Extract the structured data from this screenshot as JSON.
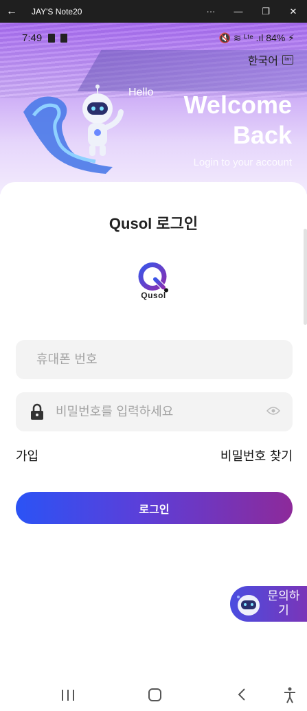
{
  "window": {
    "title": "JAY'S Note20",
    "back_glyph": "←",
    "more_glyph": "···",
    "minimize_glyph": "—",
    "restore_glyph": "❐",
    "close_glyph": "✕"
  },
  "status_bar": {
    "time": "7:49",
    "right": "🔇 ≋ ᴸᵗᵉ .ıl 84% ⚡"
  },
  "header": {
    "language": "한국어",
    "language_icon_text": "lan",
    "hello": "Hello",
    "welcome": "Welcome Back",
    "subtitle": "Login to your account"
  },
  "login": {
    "title": "Qusol 로그인",
    "logo_text": "Qusol",
    "phone_placeholder": "휴대폰 번호",
    "password_placeholder": "비밀번호를 입력하세요",
    "signup_label": "가입",
    "find_password_label": "비밀번호 찾기",
    "login_button": "로그인"
  },
  "inquiry": {
    "label": "문의하기"
  },
  "icons": {
    "lock": "lock-icon",
    "eye": "eye-icon",
    "mascot": "astronaut-mascot",
    "logo": "qusol-logo"
  },
  "colors": {
    "primary_gradient_start": "#2b53f5",
    "primary_gradient_end": "#8d2a9a",
    "hero_purple": "#a86bf0"
  }
}
